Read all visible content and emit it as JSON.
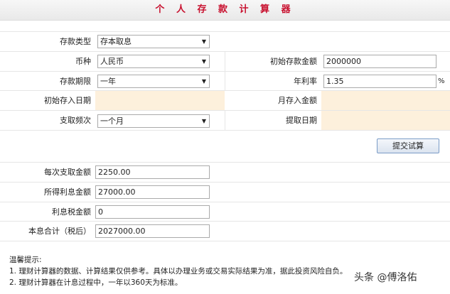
{
  "title": "个 人 存 款 计 算 器",
  "form": {
    "deposit_type_label": "存款类型",
    "deposit_type_value": "存本取息",
    "currency_label": "币种",
    "currency_value": "人民币",
    "initial_amount_label": "初始存款金额",
    "initial_amount_value": "2000000",
    "term_label": "存款期限",
    "term_value": "一年",
    "rate_label": "年利率",
    "rate_value": "1.35",
    "rate_unit": "%",
    "initial_date_label": "初始存入日期",
    "monthly_amount_label": "月存入金额",
    "frequency_label": "支取频次",
    "frequency_value": "一个月",
    "withdraw_date_label": "提取日期",
    "submit_label": "提交试算"
  },
  "results": {
    "withdraw_amount_label": "每次支取金额",
    "withdraw_amount_value": "2250.00",
    "interest_label": "所得利息金额",
    "interest_value": "27000.00",
    "tax_label": "利息税金额",
    "tax_value": "0",
    "total_label": "本息合计（税后）",
    "total_value": "2027000.00"
  },
  "notes": {
    "heading": "温馨提示:",
    "line1": "1.  理财计算器的数据、计算结果仅供参考。具体以办理业务或交易实际结果为准，据此投资风险自负。",
    "line2": "2.  理财计算器在计息过程中，一年以360天为标准。"
  },
  "watermark": "头条 @傅洛佑",
  "icons": {
    "dropdown": "chevron-down-icon"
  },
  "colors": {
    "title": "#c8102e",
    "readonly_fill": "#fdf0dc"
  }
}
